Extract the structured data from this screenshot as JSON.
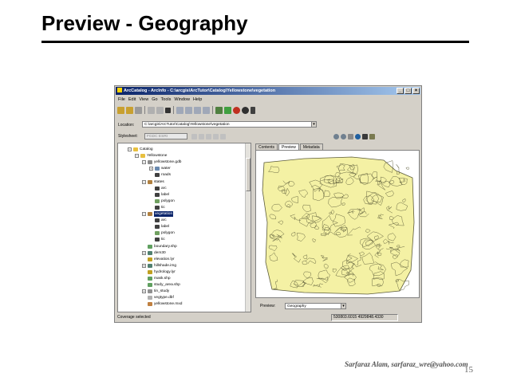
{
  "slide": {
    "title": "Preview - Geography",
    "footer": "Sarfaraz Alam, sarfaraz_wre@yahoo.com",
    "page_number": "15"
  },
  "window": {
    "title": "ArcCatalog - ArcInfo - C:\\arcgis\\ArcTutor\\Catalog\\Yellowstone\\vegetation",
    "menu": [
      "File",
      "Edit",
      "View",
      "Go",
      "Tools",
      "Window",
      "Help"
    ],
    "location_label": "Location:",
    "location_value": "C:\\arcgis\\ArcTutor\\Catalog\\Yellowstone\\vegetation",
    "stylesheet_label": "Stylesheet:",
    "stylesheet_value": "FGDC ESRI",
    "tabs": [
      "Contents",
      "Preview",
      "Metadata"
    ],
    "active_tab": "Preview",
    "preview_label": "Preview:",
    "preview_value": "Geography",
    "status_left": "Coverage selected",
    "status_coords": "530803.6015 4929848.4330"
  },
  "tree": [
    {
      "label": "Catalog",
      "icon": "folder",
      "indent": 0
    },
    {
      "label": "Yellowstone",
      "icon": "folder",
      "indent": 1
    },
    {
      "label": "yellowstone.gdb",
      "icon": "database",
      "indent": 2
    },
    {
      "label": "water",
      "icon": "dataset",
      "indent": 3
    },
    {
      "label": "roads",
      "icon": "line",
      "indent": 3
    },
    {
      "label": "states",
      "icon": "coverage",
      "indent": 2
    },
    {
      "label": "arc",
      "icon": "line",
      "indent": 3
    },
    {
      "label": "label",
      "icon": "point",
      "indent": 3
    },
    {
      "label": "polygon",
      "icon": "polygon",
      "indent": 3
    },
    {
      "label": "tic",
      "icon": "point",
      "indent": 3
    },
    {
      "label": "vegetation",
      "icon": "coverage",
      "indent": 2,
      "selected": true
    },
    {
      "label": "arc",
      "icon": "line",
      "indent": 3
    },
    {
      "label": "label",
      "icon": "point",
      "indent": 3
    },
    {
      "label": "polygon",
      "icon": "polygon",
      "indent": 3
    },
    {
      "label": "tic",
      "icon": "point",
      "indent": 3
    },
    {
      "label": "boundary.shp",
      "icon": "shapefile",
      "indent": 2
    },
    {
      "label": "dem30",
      "icon": "raster",
      "indent": 2
    },
    {
      "label": "elevation.lyr",
      "icon": "layer",
      "indent": 2
    },
    {
      "label": "hillshade.img",
      "icon": "raster",
      "indent": 2
    },
    {
      "label": "hydrology.lyr",
      "icon": "layer",
      "indent": 2
    },
    {
      "label": "mask.shp",
      "icon": "shapefile",
      "indent": 2
    },
    {
      "label": "study_area.shp",
      "icon": "shapefile",
      "indent": 2
    },
    {
      "label": "tin_study",
      "icon": "tin",
      "indent": 2
    },
    {
      "label": "vegtype.dbf",
      "icon": "table",
      "indent": 2
    },
    {
      "label": "yellowstone.mxd",
      "icon": "map",
      "indent": 2
    }
  ],
  "colors": {
    "map_fill": "#f4f1a4",
    "map_line": "#5c5c3a",
    "selection": "#0a246a",
    "titlebar": "#0a246a"
  }
}
